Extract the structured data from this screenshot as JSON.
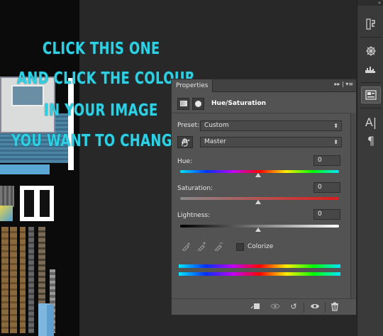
{
  "instruction": {
    "line1": "CLICK THIS ONE",
    "line2": "AND CLICK THE COLOUR",
    "line3": "IN YOUR IMAGE",
    "line4": "YOU WANT TO CHANGE >>",
    "color": "#2fd0e3"
  },
  "panel": {
    "tab_label": "Properties",
    "menu_glyph": "▸▸ | ▾≡",
    "adjustment_title": "Hue/Saturation",
    "preset_label": "Preset:",
    "preset_value": "Custom",
    "channel_value": "Master",
    "hue": {
      "label": "Hue:",
      "value": "0"
    },
    "saturation": {
      "label": "Saturation:",
      "value": "0"
    },
    "lightness": {
      "label": "Lightness:",
      "value": "0"
    },
    "colorize_label": "Colorize",
    "colorize_checked": false
  },
  "strip": {
    "collapse_glyph": "«",
    "buttons": [
      "history-icon",
      "navigator-icon",
      "histogram-icon",
      "properties-icon",
      "character-icon",
      "paragraph-icon"
    ]
  },
  "icons": {
    "select_arrows": "⬍",
    "hand": "☝",
    "eyedropper": "✎",
    "clip": "⬚",
    "view_previous": "◎",
    "reset": "↺",
    "visibility": "◉",
    "trash": "🗑"
  }
}
